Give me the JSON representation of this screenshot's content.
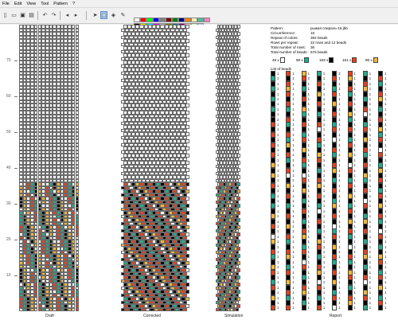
{
  "menu": [
    "File",
    "Edit",
    "View",
    "Tool",
    "Pattern",
    "?"
  ],
  "toolbar": {
    "icons": [
      "new-file-icon",
      "open-file-icon",
      "save-icon",
      "print-icon",
      "undo-icon",
      "redo-icon",
      "arrow-left-icon",
      "arrow-right-icon",
      "pointer-icon",
      "selection-icon",
      "fill-icon",
      "pipette-icon"
    ],
    "palette": [
      "#ffffff",
      "#000000",
      "#ff0000",
      "#ffff00",
      "#00ff00",
      "#00ffff",
      "#0000ff",
      "#ff00ff",
      "#808080",
      "#c0c0c0",
      "#800000",
      "#808000",
      "#008000",
      "#008080",
      "#000080",
      "#800080",
      "#ff8000",
      "#ffc0c0",
      "#fef2b0",
      "#c0ffc0",
      "#40c0a0",
      "#c0c0ff",
      "#ff80c0"
    ]
  },
  "ruler": {
    "labels": [
      "70",
      "60",
      "50",
      "40",
      "30",
      "20",
      "10"
    ]
  },
  "pane_labels": {
    "draft": "Draft",
    "corrected": "Corrected",
    "simulation": "Simulation",
    "report": "Report"
  },
  "info": [
    {
      "key": "Pattern:",
      "value": "рыжая спираль-16.jbb"
    },
    {
      "key": "Circumference:",
      "value": "16"
    },
    {
      "key": "Repeat of colors:",
      "value": "384 beads"
    },
    {
      "key": "Rows per repeat:",
      "value": "22 rows and 12 beads"
    },
    {
      "key": "Total number of rows:",
      "value": "36"
    },
    {
      "key": "Total number of beads:",
      "value": "576 beads"
    }
  ],
  "counts": [
    {
      "label": "48 x",
      "color": "#ffffff"
    },
    {
      "label": "98 x",
      "color": "#1fae8c"
    },
    {
      "label": "183 x",
      "color": "#000000"
    },
    {
      "label": "161 x",
      "color": "#e8401a"
    },
    {
      "label": "86 x",
      "color": "#f7b731"
    }
  ],
  "list_title": "List of beads",
  "colors": {
    "w": "#ffffff",
    "k": "#000000",
    "r": "#e8401a",
    "g": "#1fae8c",
    "y": "#f7b731"
  },
  "report": {
    "columns": [
      [
        "k",
        "g",
        "k",
        "g",
        "k",
        "g",
        "k",
        "g",
        "k",
        "k",
        "r",
        "k",
        "r",
        "k",
        "r",
        "k",
        "r",
        "k",
        "y",
        "k",
        "y",
        "k",
        "r",
        "k",
        "g",
        "k",
        "g",
        "k",
        "y",
        "k",
        "r",
        "k",
        "w",
        "y",
        "k",
        "r",
        "g",
        "k",
        "y",
        "r",
        "k",
        "g",
        "r",
        "k",
        "y",
        "k",
        "r"
      ],
      [
        "r",
        "k",
        "r",
        "y",
        "r",
        "k",
        "r",
        "g",
        "k",
        "r",
        "g",
        "k",
        "r",
        "g",
        "y",
        "k",
        "r",
        "g",
        "k",
        "r",
        "w",
        "k",
        "y",
        "k",
        "r",
        "k",
        "g",
        "k",
        "r",
        "k",
        "y",
        "k",
        "r",
        "g",
        "k",
        "r",
        "y",
        "k",
        "g",
        "r",
        "k",
        "y",
        "k",
        "r",
        "g",
        "k",
        "r"
      ],
      [
        "y",
        "r",
        "k",
        "g",
        "k",
        "r",
        "k",
        "y",
        "g",
        "k",
        "r",
        "k",
        "g",
        "r",
        "k",
        "y",
        "k",
        "r",
        "g",
        "k",
        "w",
        "r",
        "k",
        "y",
        "k",
        "g",
        "k",
        "r",
        "k",
        "g",
        "k",
        "r",
        "y",
        "k",
        "g",
        "r",
        "k",
        "w",
        "r",
        "k",
        "g",
        "k",
        "r",
        "y",
        "k",
        "g",
        "k"
      ],
      [
        "g",
        "k",
        "r",
        "k",
        "y",
        "k",
        "r",
        "k",
        "g",
        "k",
        "r",
        "w",
        "k",
        "r",
        "g",
        "k",
        "y",
        "r",
        "k",
        "g",
        "k",
        "r",
        "y",
        "k",
        "r",
        "k",
        "g",
        "w",
        "k",
        "r",
        "k",
        "g",
        "k",
        "y",
        "r",
        "k",
        "g",
        "k",
        "r",
        "y",
        "k",
        "w",
        "r",
        "k",
        "g",
        "k",
        "r"
      ],
      [
        "k",
        "r",
        "k",
        "g",
        "r",
        "k",
        "y",
        "k",
        "r",
        "k",
        "g",
        "r",
        "k",
        "w",
        "k",
        "r",
        "g",
        "k",
        "r",
        "y",
        "k",
        "g",
        "k",
        "r",
        "k",
        "g",
        "y",
        "k",
        "r",
        "k",
        "w",
        "g",
        "r",
        "k",
        "y",
        "k",
        "r",
        "g",
        "k",
        "r",
        "k",
        "y",
        "k",
        "g",
        "r",
        "k",
        "w"
      ],
      [
        "r",
        "y",
        "k",
        "r",
        "g",
        "k",
        "r",
        "k",
        "y",
        "g",
        "k",
        "r",
        "k",
        "g",
        "r",
        "k",
        "y",
        "k",
        "w",
        "r",
        "k",
        "g",
        "r",
        "k",
        "y",
        "k",
        "g",
        "r",
        "k",
        "y",
        "k",
        "r",
        "g",
        "k",
        "w",
        "k",
        "r",
        "g",
        "k",
        "y",
        "r",
        "k",
        "g",
        "k",
        "r",
        "y",
        "k"
      ],
      [
        "g",
        "k",
        "r",
        "y",
        "k",
        "g",
        "k",
        "r",
        "w",
        "k",
        "g",
        "r",
        "k",
        "y",
        "k",
        "r",
        "g",
        "k",
        "r",
        "k",
        "y",
        "g",
        "k",
        "r",
        "k",
        "w",
        "r",
        "k",
        "g",
        "y",
        "k",
        "r",
        "k",
        "g",
        "k",
        "r",
        "y",
        "k",
        "g",
        "k",
        "r",
        "w",
        "k",
        "y",
        "r",
        "k",
        "g"
      ],
      [
        "k",
        "r",
        "g",
        "k",
        "r",
        "y",
        "k",
        "g",
        "k",
        "r",
        "k",
        "y",
        "g",
        "r",
        "k",
        "w",
        "r",
        "k",
        "g",
        "y",
        "k",
        "r",
        "k",
        "g",
        "r",
        "k",
        "y",
        "k",
        "r",
        "g",
        "k",
        "w",
        "r",
        "k",
        "g",
        "k",
        "y",
        "r",
        "k",
        "g",
        "r",
        "k",
        "y",
        "k",
        "g",
        "r",
        "k"
      ]
    ],
    "numbers": [
      [
        "1",
        "1",
        "1",
        "1",
        "1",
        "1",
        "1",
        "1",
        "1",
        "2",
        "1",
        "1",
        "1",
        "1",
        "1",
        "1",
        "1",
        "1",
        "1",
        "1",
        "1",
        "1",
        "1",
        "1",
        "1",
        "1",
        "1",
        "1",
        "1",
        "1",
        "1",
        "1",
        "1",
        "1",
        "1",
        "1",
        "1",
        "1",
        "1",
        "1",
        "1",
        "1",
        "1",
        "1",
        "1",
        "1",
        "1"
      ],
      [
        "1",
        "1",
        "1",
        "1",
        "1",
        "1",
        "1",
        "1",
        "1",
        "1",
        "1",
        "1",
        "1",
        "1",
        "1",
        "1",
        "1",
        "1",
        "1",
        "1",
        "1",
        "1",
        "1",
        "1",
        "1",
        "1",
        "1",
        "1",
        "1",
        "1",
        "1",
        "1",
        "1",
        "1",
        "1",
        "1",
        "1",
        "1",
        "1",
        "1",
        "1",
        "1",
        "1",
        "1",
        "1",
        "1",
        "1"
      ],
      [
        "1",
        "2",
        "1",
        "1",
        "1",
        "1",
        "1",
        "1",
        "1",
        "1",
        "1",
        "1",
        "1",
        "1",
        "1",
        "1",
        "1",
        "1",
        "1",
        "1",
        "1",
        "1",
        "1",
        "1",
        "1",
        "1",
        "1",
        "1",
        "1",
        "1",
        "1",
        "1",
        "1",
        "1",
        "1",
        "1",
        "1",
        "1",
        "1",
        "1",
        "1",
        "1",
        "1",
        "1",
        "1",
        "1",
        "1"
      ],
      [
        "1",
        "1",
        "1",
        "1",
        "1",
        "1",
        "1",
        "1",
        "1",
        "1",
        "1",
        "1",
        "1",
        "1",
        "1",
        "1",
        "1",
        "1",
        "1",
        "1",
        "1",
        "1",
        "1",
        "1",
        "1",
        "1",
        "1",
        "1",
        "1",
        "1",
        "1",
        "1",
        "1",
        "1",
        "1",
        "1",
        "1",
        "1",
        "1",
        "1",
        "1",
        "1",
        "1",
        "1",
        "1",
        "1",
        "1"
      ],
      [
        "2",
        "1",
        "1",
        "1",
        "1",
        "1",
        "1",
        "1",
        "1",
        "1",
        "1",
        "1",
        "1",
        "1",
        "1",
        "1",
        "1",
        "1",
        "1",
        "1",
        "1",
        "1",
        "1",
        "1",
        "1",
        "1",
        "1",
        "1",
        "1",
        "1",
        "1",
        "1",
        "1",
        "1",
        "1",
        "1",
        "1",
        "1",
        "1",
        "1",
        "1",
        "1",
        "1",
        "1",
        "1",
        "1",
        "1"
      ],
      [
        "1",
        "1",
        "1",
        "1",
        "1",
        "1",
        "1",
        "1",
        "1",
        "1",
        "1",
        "1",
        "1",
        "1",
        "1",
        "1",
        "1",
        "1",
        "1",
        "1",
        "1",
        "1",
        "1",
        "1",
        "1",
        "1",
        "1",
        "1",
        "1",
        "1",
        "1",
        "1",
        "1",
        "1",
        "1",
        "1",
        "1",
        "1",
        "1",
        "1",
        "1",
        "1",
        "1",
        "1",
        "1",
        "1",
        "1"
      ],
      [
        "1",
        "1",
        "1",
        "1",
        "1",
        "1",
        "1",
        "1",
        "1",
        "1",
        "1",
        "1",
        "1",
        "1",
        "1",
        "1",
        "1",
        "1",
        "1",
        "1",
        "1",
        "1",
        "1",
        "1",
        "1",
        "1",
        "1",
        "1",
        "1",
        "1",
        "1",
        "1",
        "1",
        "1",
        "1",
        "1",
        "1",
        "1",
        "1",
        "1",
        "1",
        "1",
        "1",
        "1",
        "1",
        "1",
        "1"
      ],
      [
        "1",
        "1",
        "1",
        "1",
        "1",
        "1",
        "1",
        "1",
        "1",
        "1",
        "1",
        "1",
        "1",
        "1",
        "1",
        "1",
        "1",
        "1",
        "1",
        "1",
        "1",
        "1",
        "1",
        "1",
        "1",
        "1",
        "1",
        "1",
        "1",
        "1",
        "1",
        "1",
        "1",
        "1",
        "1",
        "1",
        "1",
        "1",
        "1",
        "1",
        "1",
        "1",
        "1",
        "1",
        "1",
        "1",
        "1"
      ]
    ]
  }
}
